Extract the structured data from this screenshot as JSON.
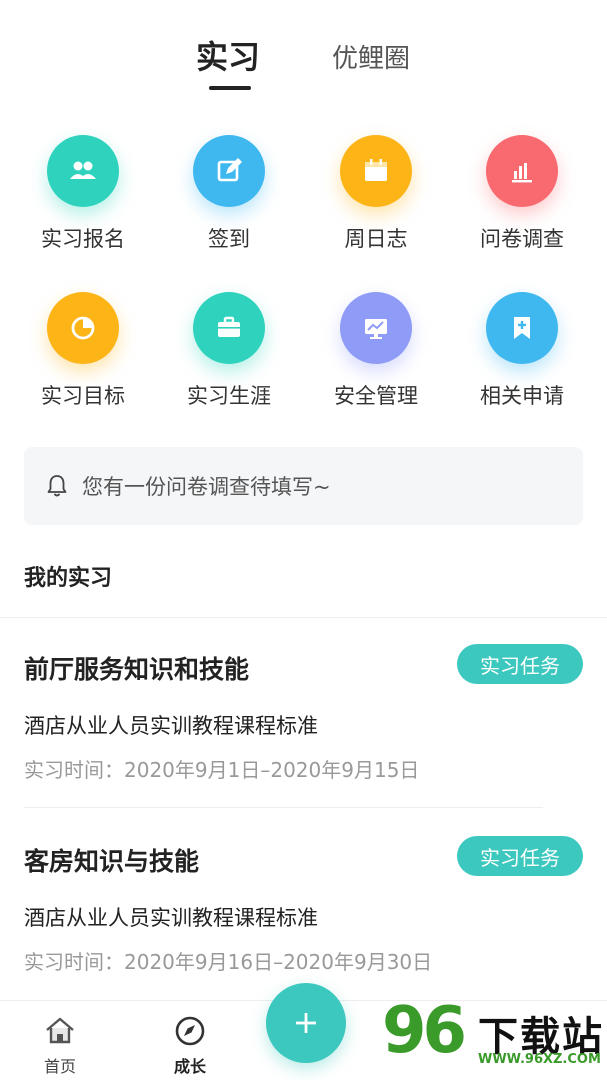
{
  "tabs": {
    "active": "实习",
    "other": "优鲤圈"
  },
  "grid": [
    {
      "label": "实习报名",
      "icon": "people-icon",
      "color": "#2fd3bd"
    },
    {
      "label": "签到",
      "icon": "edit-icon",
      "color": "#3fb8f0"
    },
    {
      "label": "周日志",
      "icon": "calendar-icon",
      "color": "#fdb416"
    },
    {
      "label": "问卷调查",
      "icon": "bar-chart-icon",
      "color": "#f86a6f"
    },
    {
      "label": "实习目标",
      "icon": "pie-chart-icon",
      "color": "#fdb416"
    },
    {
      "label": "实习生涯",
      "icon": "briefcase-icon",
      "color": "#2fd3bd"
    },
    {
      "label": "安全管理",
      "icon": "monitor-icon",
      "color": "#8e9cf7"
    },
    {
      "label": "相关申请",
      "icon": "bookmark-plus-icon",
      "color": "#3fb8f0"
    }
  ],
  "notice": {
    "text": "您有一份问卷调查待填写~",
    "icon": "bell-icon"
  },
  "section": {
    "title": "我的实习"
  },
  "cards": [
    {
      "title": "前厅服务知识和技能",
      "badge": "实习任务",
      "subtitle": "酒店从业人员实训教程课程标准",
      "time_label": "实习时间：",
      "time_value": "2020年9月1日–2020年9月15日"
    },
    {
      "title": "客房知识与技能",
      "badge": "实习任务",
      "subtitle": "酒店从业人员实训教程课程标准",
      "time_label": "实习时间：",
      "time_value": "2020年9月16日–2020年9月30日"
    }
  ],
  "nav": {
    "home": "首页",
    "growth": "成长"
  },
  "watermark": {
    "number": "96",
    "text": "下载站",
    "url": "WWW.96XZ.COM"
  },
  "colors": {
    "accent": "#3cc8be"
  }
}
